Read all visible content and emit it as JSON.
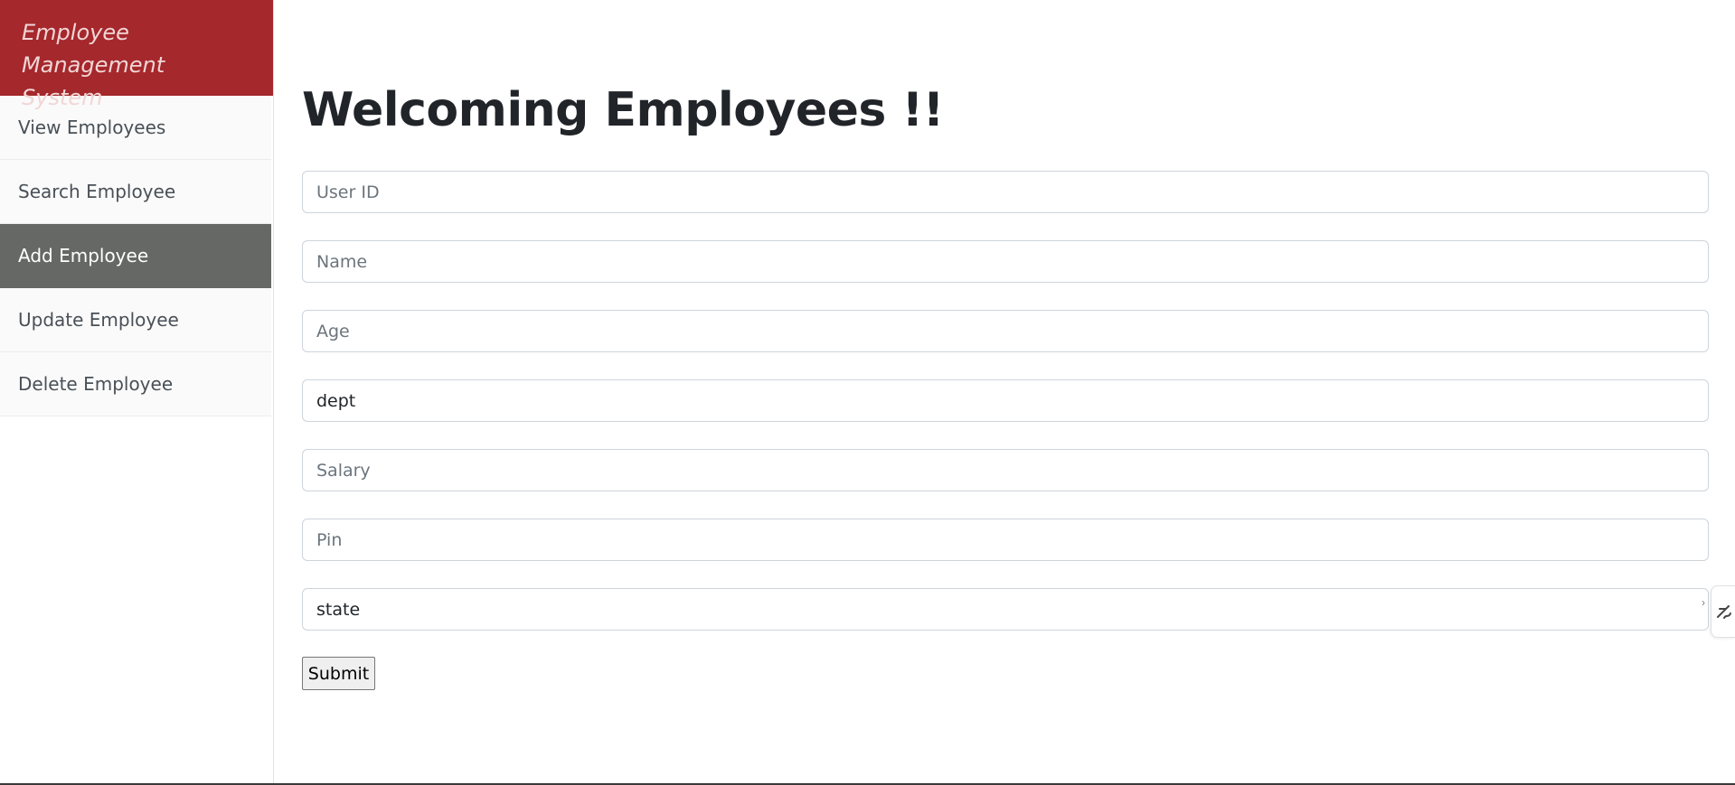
{
  "sidebar": {
    "brand": "Employee Management System",
    "items": [
      {
        "label": "View Employees",
        "active": false
      },
      {
        "label": "Search Employee",
        "active": false
      },
      {
        "label": "Add Employee",
        "active": true
      },
      {
        "label": "Update Employee",
        "active": false
      },
      {
        "label": "Delete Employee",
        "active": false
      }
    ]
  },
  "main": {
    "title": "Welcoming Employees !!",
    "fields": {
      "user_id": {
        "placeholder": "User ID",
        "value": ""
      },
      "name": {
        "placeholder": "Name",
        "value": ""
      },
      "age": {
        "placeholder": "Age",
        "value": ""
      },
      "dept": {
        "placeholder": "",
        "value": "dept"
      },
      "salary": {
        "placeholder": "Salary",
        "value": ""
      },
      "pin": {
        "placeholder": "Pin",
        "value": ""
      },
      "state": {
        "placeholder": "",
        "value": "state"
      }
    },
    "submit_label": "Submit"
  },
  "colors": {
    "brand_bg": "#a5282c",
    "active_item_bg": "#666866"
  },
  "icons": {
    "autofill_indicator": "chevron-right-icon",
    "edge_widget": "pen-icon"
  }
}
